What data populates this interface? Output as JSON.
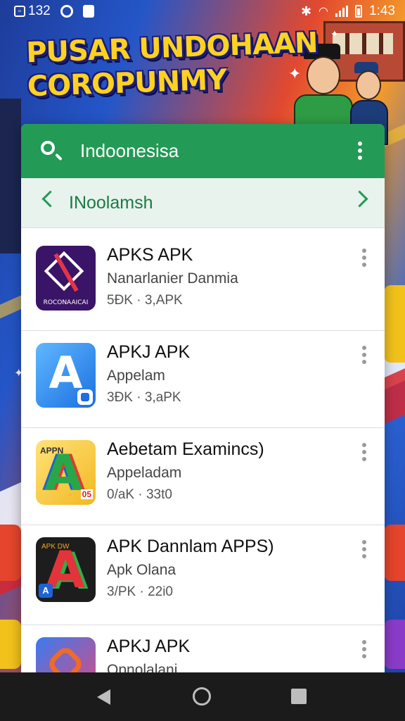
{
  "status_bar": {
    "notification_count": "132",
    "time": "1:43",
    "icons": [
      "notification-box-icon",
      "app-notification-icon",
      "shopping-bag-icon",
      "bluetooth-icon",
      "wifi-icon",
      "signal-icon",
      "battery-icon"
    ]
  },
  "banner": {
    "title": "PUSAR UNDOHAAN COROPUNMY"
  },
  "search": {
    "query": "Indoonesisa",
    "suggestion": "INoolamsh"
  },
  "results": [
    {
      "title": "APKS APK",
      "developer": "Nanarlanier Danmia",
      "meta": "5ÐK · 3,APK",
      "icon_caption": "ROCONAAICAI",
      "icon": "diamond-logo-icon"
    },
    {
      "title": "APKJ APK",
      "developer": "Appelam",
      "meta": "3ÐK · 3,aPK",
      "icon": "app-store-a-icon"
    },
    {
      "title": "Aebetam Examincs)",
      "developer": "Appeladam",
      "meta": "0/aK · 33t0",
      "icon_tag": "APPN",
      "icon_corner": "05",
      "icon": "colorful-a-icon"
    },
    {
      "title": "APK Dannlam APPS)",
      "developer": "Apk Olana",
      "meta": "3/PK · 22i0",
      "icon_tag": "APK DW",
      "icon_corner": "A",
      "icon": "dark-a-icon"
    },
    {
      "title": "APKJ APK",
      "developer": "Opnolalani",
      "meta": "",
      "icon": "heart-logo-icon"
    }
  ],
  "colors": {
    "search_bar": "#239a55",
    "suggestion_bar": "#e7f3ec",
    "banner_title": "#ffd21f",
    "nav_bar": "#1b1b1b"
  },
  "nav": {
    "icons": [
      "back-icon",
      "home-icon",
      "recents-icon"
    ]
  }
}
